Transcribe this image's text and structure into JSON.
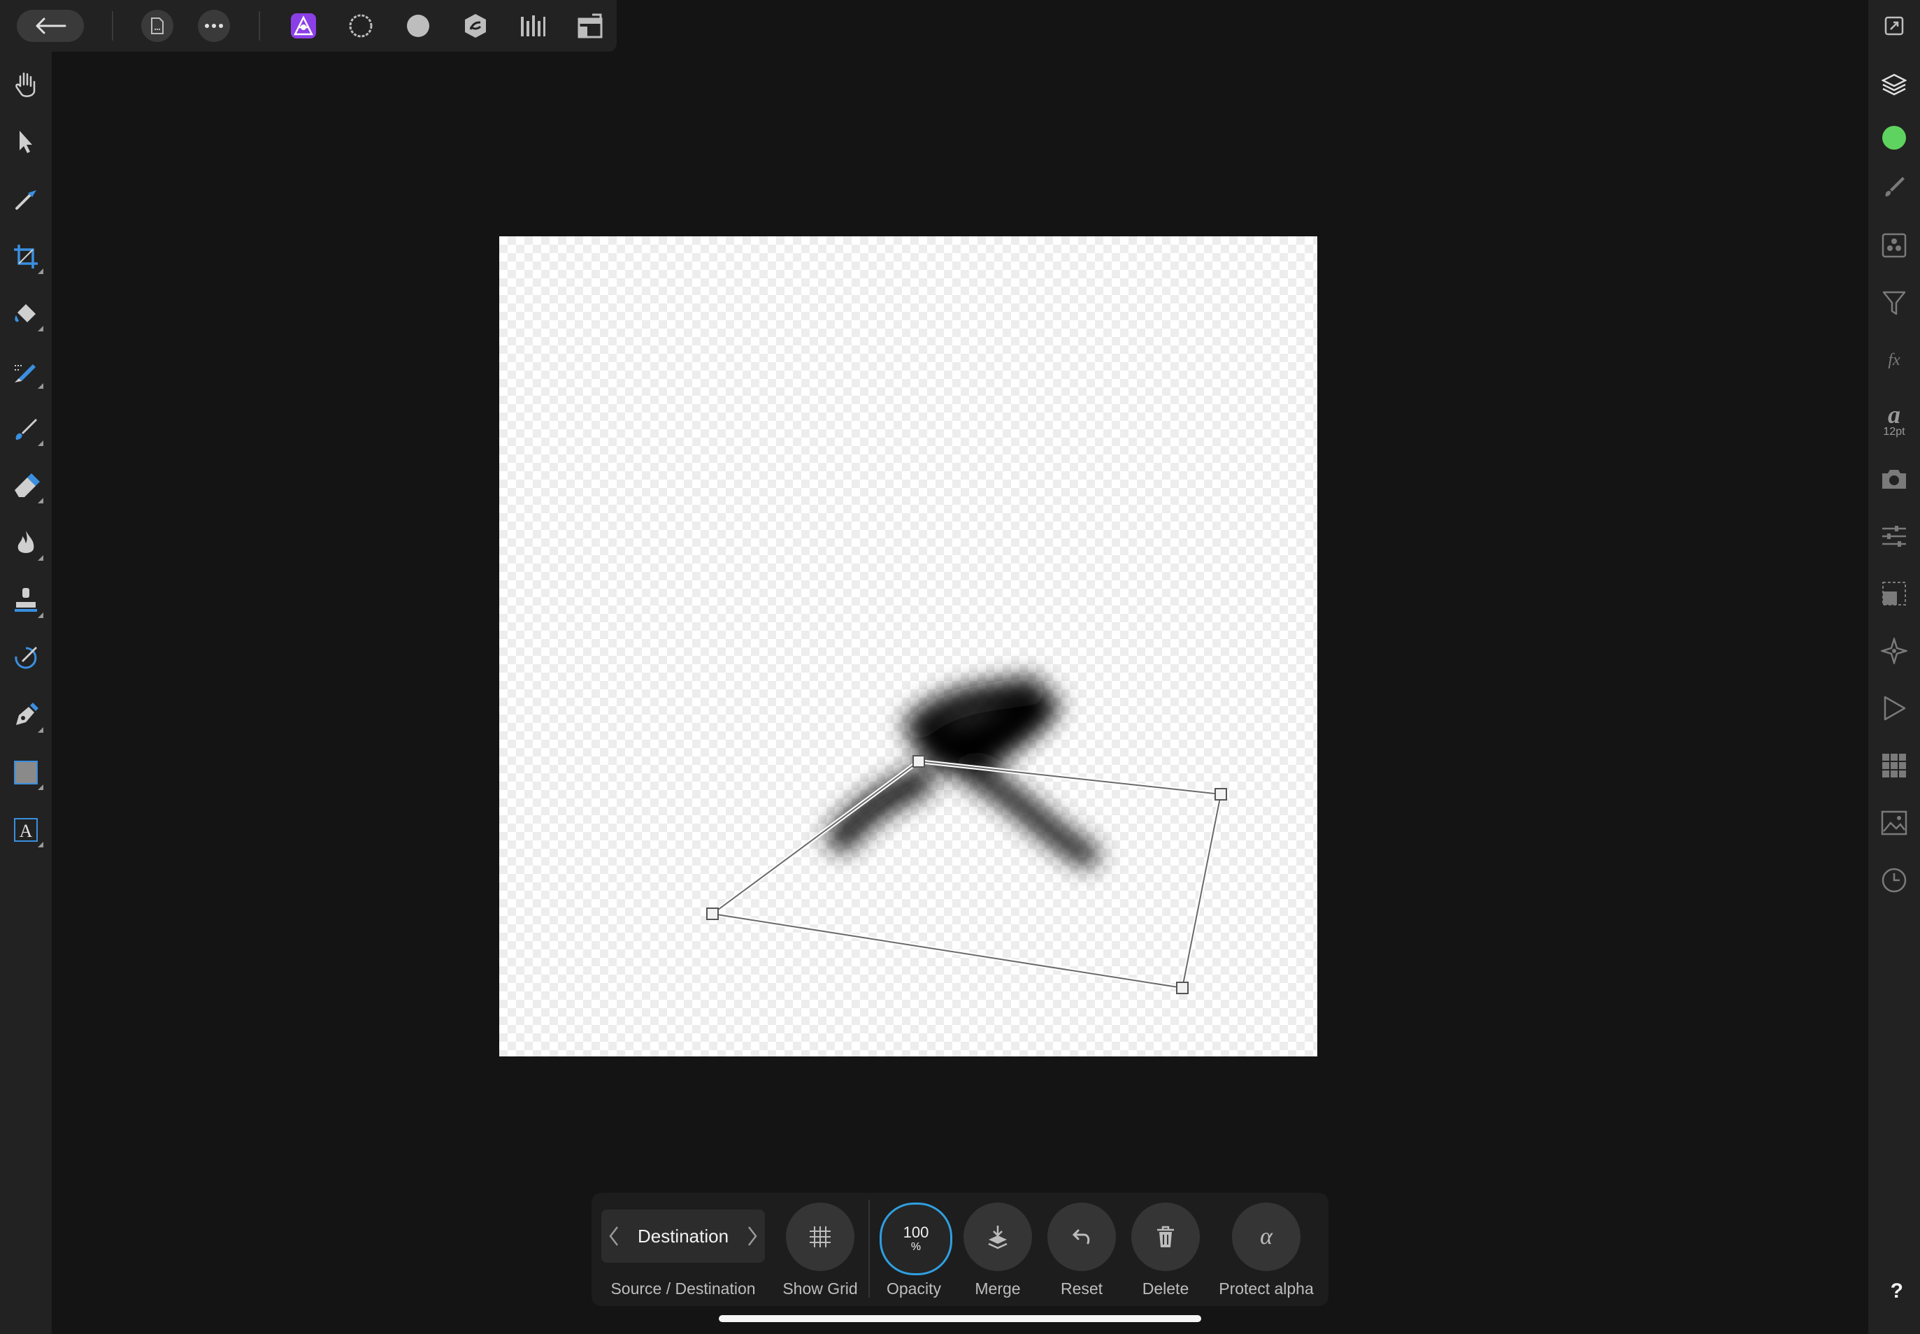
{
  "top_toolbar": {
    "back_label": "back",
    "personas": [
      "photo-persona",
      "liquify-persona",
      "develop-persona",
      "tone-mapping-persona",
      "export-persona"
    ]
  },
  "right_studio": {
    "text_size": "12pt",
    "color_swatch": "#5fd35f",
    "help": "?"
  },
  "context_toolbar": {
    "mode_value": "Destination",
    "mode_caption": "Source / Destination",
    "show_grid": "Show Grid",
    "opacity_value": "100",
    "opacity_unit": "%",
    "opacity_label": "Opacity",
    "merge": "Merge",
    "reset": "Reset",
    "delete": "Delete",
    "protect_alpha": "Protect alpha",
    "accent": "#2f9fe0"
  }
}
